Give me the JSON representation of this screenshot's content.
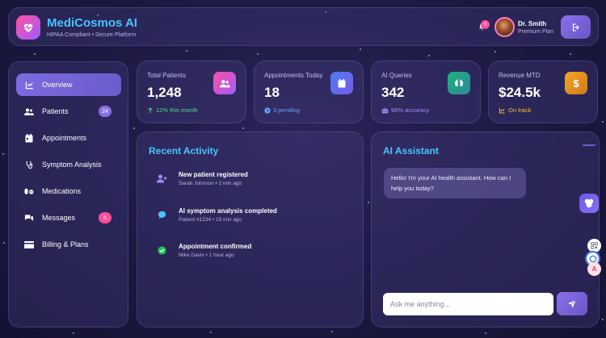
{
  "brand": {
    "title": "MediCosmos AI",
    "subtitle": "HIPAA Compliant • Secure Platform"
  },
  "header": {
    "notification_count": "3",
    "user_name": "Dr. Smith",
    "user_plan": "Premium Plan"
  },
  "sidebar": {
    "items": [
      {
        "label": "Overview",
        "icon": "chart-line-icon",
        "active": true
      },
      {
        "label": "Patients",
        "icon": "users-icon",
        "badge": "24"
      },
      {
        "label": "Appointments",
        "icon": "calendar-icon"
      },
      {
        "label": "Symptom Analysis",
        "icon": "stethoscope-icon"
      },
      {
        "label": "Medications",
        "icon": "pills-icon"
      },
      {
        "label": "Messages",
        "icon": "comments-icon",
        "badge": "5"
      },
      {
        "label": "Billing & Plans",
        "icon": "credit-card-icon"
      }
    ]
  },
  "stats": [
    {
      "label": "Total Patients",
      "value": "1,248",
      "sub": "12% this month",
      "sub_color": "#4ade80",
      "icon": "users-icon"
    },
    {
      "label": "Appointments Today",
      "value": "18",
      "sub": "3 pending",
      "sub_color": "#60a5fa",
      "icon": "calendar-icon"
    },
    {
      "label": "AI Queries",
      "value": "342",
      "sub": "98% accuracy",
      "sub_color": "#a78bfa",
      "icon": "brain-icon"
    },
    {
      "label": "Revenue MTD",
      "value": "$24.5k",
      "sub": "On track",
      "sub_color": "#fbbf24",
      "icon": "dollar-icon"
    }
  ],
  "activity": {
    "title": "Recent Activity",
    "items": [
      {
        "title": "New patient registered",
        "meta": "Sarah Johnson • 2 min ago",
        "icon": "user-plus-icon"
      },
      {
        "title": "AI symptom analysis completed",
        "meta": "Patient #1234 • 15 min ago",
        "icon": "chat-bubble-icon"
      },
      {
        "title": "Appointment confirmed",
        "meta": "Mike Davis • 1 hour ago",
        "icon": "check-circle-icon"
      }
    ]
  },
  "assistant": {
    "title": "AI Assistant",
    "greeting": "Hello! I'm your AI health assistant. How can I help you today?",
    "input_placeholder": "Ask me anything..."
  },
  "colors": {
    "accent": "#47c4ff",
    "primary": "#7c6be0",
    "badge_pink": "#ff4f9a"
  }
}
